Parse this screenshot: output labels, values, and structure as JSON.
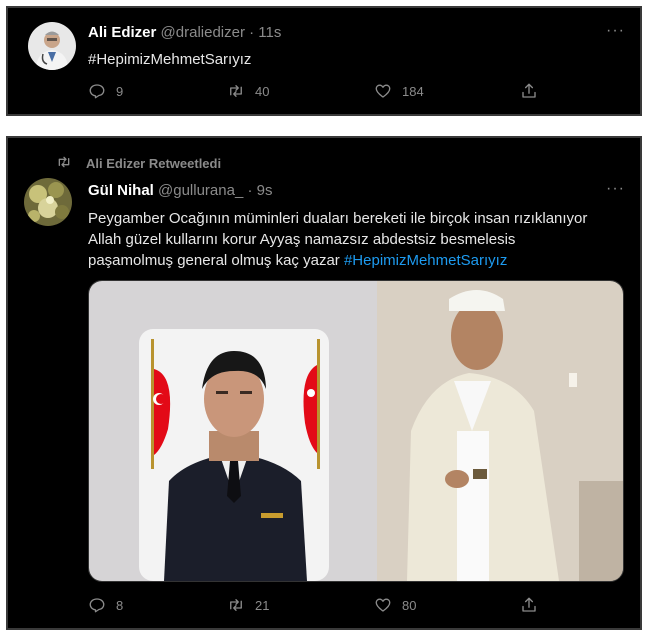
{
  "tweet1": {
    "author_name": "Ali Edizer",
    "author_handle": "@draliedizer",
    "time": "· 11s",
    "text": "#HepimizMehmetSarıyız",
    "more": "···",
    "replies": "9",
    "retweets": "40",
    "likes": "184"
  },
  "tweet2": {
    "retweet_label": "Ali Edizer Retweetledi",
    "author_name": "Gül Nihal",
    "author_handle": "@gullurana_",
    "time": "· 9s",
    "more": "···",
    "text_line1": "Peygamber Ocağının müminleri duaları bereketi ile birçok insan rızıklanıyor",
    "text_line2": "Allah güzel kullarını korur Ayyaş namazsız abdestsiz besmelesis",
    "text_line3": "paşamolmuş general olmuş kaç yazar",
    "hashtag": "#HepimizMehmetSarıyız",
    "replies": "8",
    "retweets": "21",
    "likes": "80"
  },
  "colors": {
    "background": "#000000",
    "link": "#1d9bf0",
    "muted": "#8b8b8b",
    "flag_red": "#e30a17"
  },
  "icons": [
    "reply-icon",
    "retweet-icon",
    "like-icon",
    "share-icon",
    "more-icon"
  ]
}
